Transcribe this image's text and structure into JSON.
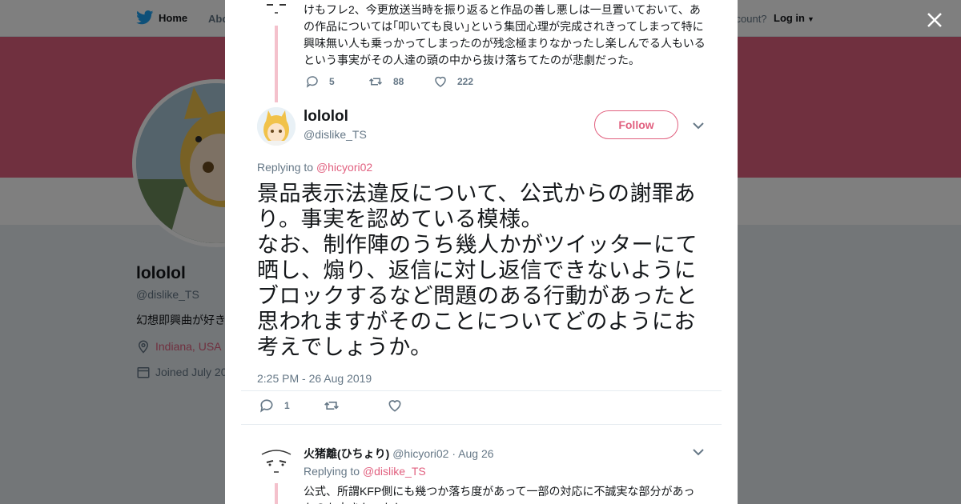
{
  "background": {
    "nav": {
      "home": "Home",
      "about": "Abo",
      "account_prompt": "ccount?",
      "login": "Log in"
    },
    "profile": {
      "name": "lololol",
      "handle": "@dislike_TS",
      "bio": "幻想即興曲が好き",
      "location": "Indiana, USA",
      "joined": "Joined July 20"
    }
  },
  "modal": {
    "parent_tweet": {
      "text": "けもフレ2、今更放送当時を振り返ると作品の善し悪しは一旦置いておいて、あの作品については｢叩いても良い｣という集団心理が完成されきってしまって特に興味無い人も乗っかってしまったのが残念極まりなかったし楽しんでる人もいるという事実がその人達の頭の中から抜け落ちてたのが悲劇だった。",
      "replies": "5",
      "retweets": "88",
      "likes": "222"
    },
    "main_tweet": {
      "author_name": "lololol",
      "author_handle": "@dislike_TS",
      "follow_label": "Follow",
      "replying_prefix": "Replying to ",
      "replying_to": "@hicyori02",
      "text": "景品表示法違反について、公式からの謝罪あり。事実を認めている模様。\nなお、制作陣のうち幾人かがツイッターにて晒し、煽り、返信に対し返信できないようにブロックするなど問題のある行動があったと思われますがそのことについてどのようにお考えでしょうか。",
      "timestamp": "2:25 PM - 26 Aug 2019",
      "replies": "1"
    },
    "reply_tweet": {
      "author_name": "火猪離(ひちょり)",
      "author_handle": "@hicyori02",
      "separator": " · ",
      "date": "Aug 26",
      "replying_prefix": "Replying to ",
      "replying_to": "@dislike_TS",
      "text": "公式、所謂KFP側にも幾つか落ち度があって一部の対応に不誠実な部分があったのも大きかったし"
    }
  },
  "colors": {
    "accent": "#e1607f",
    "twitter_blue": "#1da1f2",
    "thread_line": "#f4c1cc"
  }
}
